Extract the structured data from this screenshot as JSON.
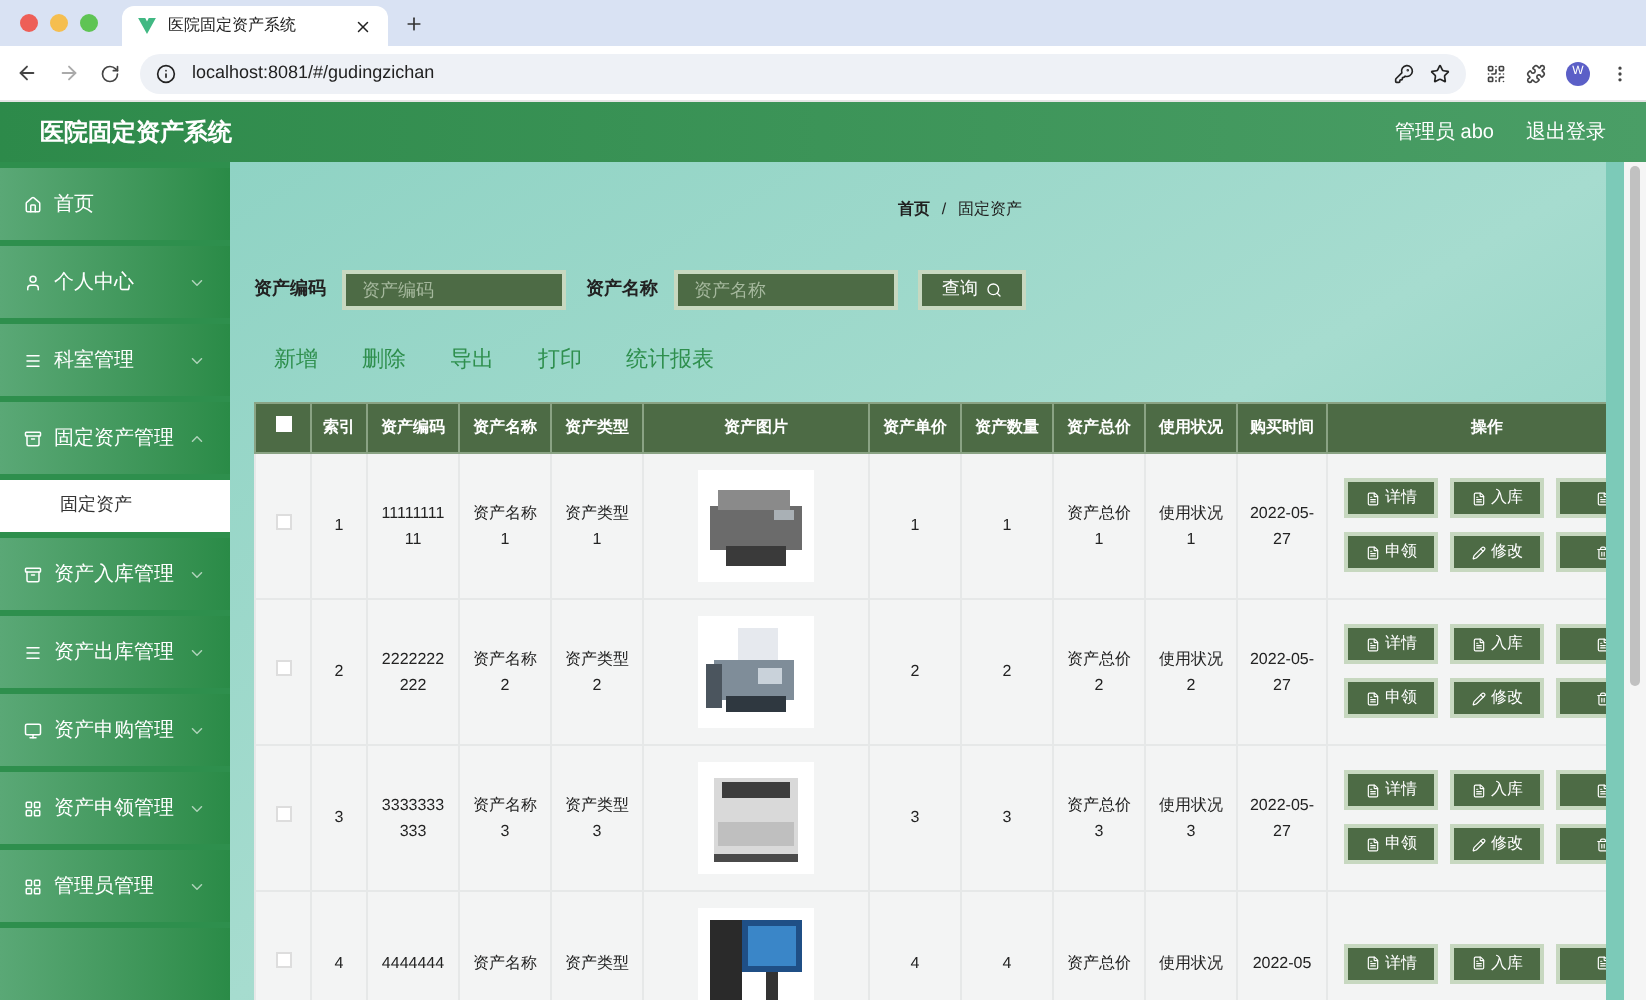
{
  "browser": {
    "tab_title": "医院固定资产系统",
    "url": "localhost:8081/#/gudingzichan",
    "avatar": "W"
  },
  "header": {
    "title": "医院固定资产系统",
    "user": "管理员 abo",
    "logout": "退出登录"
  },
  "sidebar": {
    "items": [
      {
        "label": "首页",
        "kind": "home"
      },
      {
        "label": "个人中心",
        "kind": "user",
        "expanded": false
      },
      {
        "label": "科室管理",
        "kind": "list",
        "expanded": false
      },
      {
        "label": "固定资产管理",
        "kind": "box",
        "expanded": true,
        "children": [
          {
            "label": "固定资产",
            "selected": true
          }
        ]
      },
      {
        "label": "资产入库管理",
        "kind": "box",
        "expanded": false
      },
      {
        "label": "资产出库管理",
        "kind": "list",
        "expanded": false
      },
      {
        "label": "资产申购管理",
        "kind": "monitor",
        "expanded": false
      },
      {
        "label": "资产申领管理",
        "kind": "grid",
        "expanded": false
      },
      {
        "label": "管理员管理",
        "kind": "grid",
        "expanded": false
      }
    ]
  },
  "breadcrumb": {
    "items": [
      "首页",
      "固定资产"
    ],
    "separator": "/"
  },
  "search": {
    "fields": [
      {
        "label": "资产编码",
        "placeholder": "资产编码"
      },
      {
        "label": "资产名称",
        "placeholder": "资产名称"
      }
    ],
    "button": "查询"
  },
  "actions": [
    "新增",
    "删除",
    "导出",
    "打印",
    "统计报表"
  ],
  "table": {
    "select_all": false,
    "columns": [
      "索引",
      "资产编码",
      "资产名称",
      "资产类型",
      "资产图片",
      "资产单价",
      "资产数量",
      "资产总价",
      "使用状况",
      "购买时间",
      "操作"
    ],
    "rows": [
      {
        "checked": false,
        "cells": [
          "1",
          "1111111111",
          "资产名称1",
          "资产类型1",
          "",
          "1",
          "1",
          "资产总价1",
          "使用状况1",
          "2022-05-27"
        ],
        "buttons": [
          {
            "label": "详情",
            "kind": "doc"
          },
          {
            "label": "入库",
            "kind": "doc"
          },
          {
            "kind": "doc"
          },
          {
            "label": "申领",
            "kind": "doc"
          },
          {
            "label": "修改",
            "kind": "edit"
          },
          {
            "kind": "trash"
          }
        ]
      },
      {
        "checked": false,
        "cells": [
          "2",
          "2222222222",
          "资产名称2",
          "资产类型2",
          "",
          "2",
          "2",
          "资产总价2",
          "使用状况2",
          "2022-05-27"
        ],
        "buttons": [
          {
            "label": "详情",
            "kind": "doc"
          },
          {
            "label": "入库",
            "kind": "doc"
          },
          {
            "kind": "doc"
          },
          {
            "label": "申领",
            "kind": "doc"
          },
          {
            "label": "修改",
            "kind": "edit"
          },
          {
            "kind": "trash"
          }
        ]
      },
      {
        "checked": false,
        "cells": [
          "3",
          "3333333333",
          "资产名称3",
          "资产类型3",
          "",
          "3",
          "3",
          "资产总价3",
          "使用状况3",
          "2022-05-27"
        ],
        "buttons": [
          {
            "label": "详情",
            "kind": "doc"
          },
          {
            "label": "入库",
            "kind": "doc"
          },
          {
            "kind": "doc"
          },
          {
            "label": "申领",
            "kind": "doc"
          },
          {
            "label": "修改",
            "kind": "edit"
          },
          {
            "kind": "trash"
          }
        ]
      },
      {
        "checked": false,
        "cells": [
          "4",
          "4444444",
          "资产名称",
          "资产类型",
          "",
          "4",
          "4",
          "资产总价",
          "使用状况",
          "2022-05"
        ],
        "buttons": [
          {
            "label": "详情",
            "kind": "doc"
          },
          {
            "label": "入库",
            "kind": "doc"
          },
          {
            "kind": "doc"
          }
        ]
      }
    ]
  }
}
